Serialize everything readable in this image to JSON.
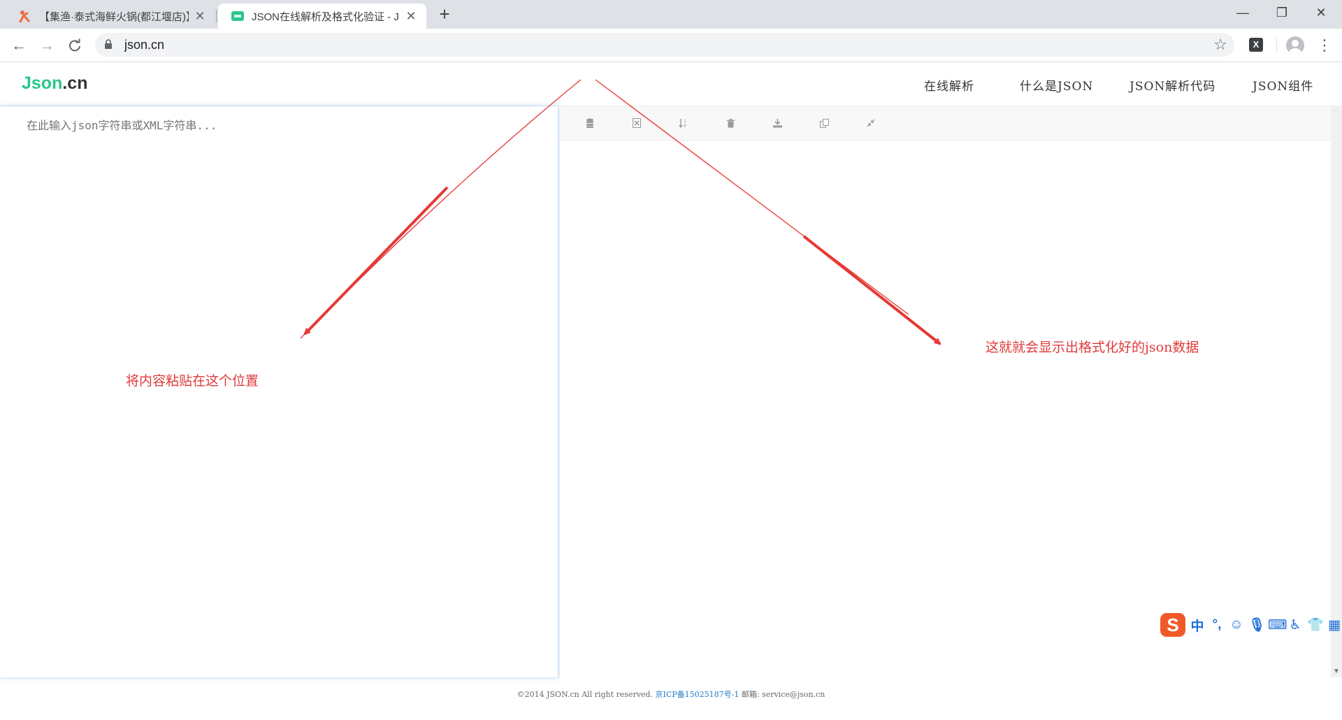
{
  "browser": {
    "tabs": [
      {
        "title": "【集渔·泰式海鲜火锅(都江堰店)】",
        "close": "✕"
      },
      {
        "title": "JSON在线解析及格式化验证 - JS",
        "close": "✕"
      }
    ],
    "new_tab": "+",
    "window": {
      "minimize": "—",
      "maximize": "❐",
      "close": "✕"
    },
    "address": "json.cn",
    "extension_label": "X"
  },
  "site": {
    "logo_main": "Json",
    "logo_suffix": ".cn",
    "nav": [
      "在线解析",
      "什么是JSON",
      "JSON解析代码",
      "JSON组件"
    ]
  },
  "editor": {
    "placeholder": "在此输入json字符串或XML字符串..."
  },
  "annotations": {
    "left": "将内容粘贴在这个位置",
    "right": "这就就会显示出格式化好的json数据"
  },
  "ime": {
    "logo": "S",
    "items": [
      "中",
      "°,",
      "☺",
      "🎙",
      "⌨",
      "♿",
      "👕",
      "▦"
    ]
  },
  "footer": {
    "copyright": "©2014 JSON.cn All right reserved.",
    "icp": "京ICP备15025187号-1",
    "email": "邮箱: service@json.cn"
  },
  "colors": {
    "brand_green": "#2cc68b",
    "annotation_red": "#e03a3a",
    "ime_orange": "#f05a28",
    "icp_link": "#1f7ac7"
  }
}
